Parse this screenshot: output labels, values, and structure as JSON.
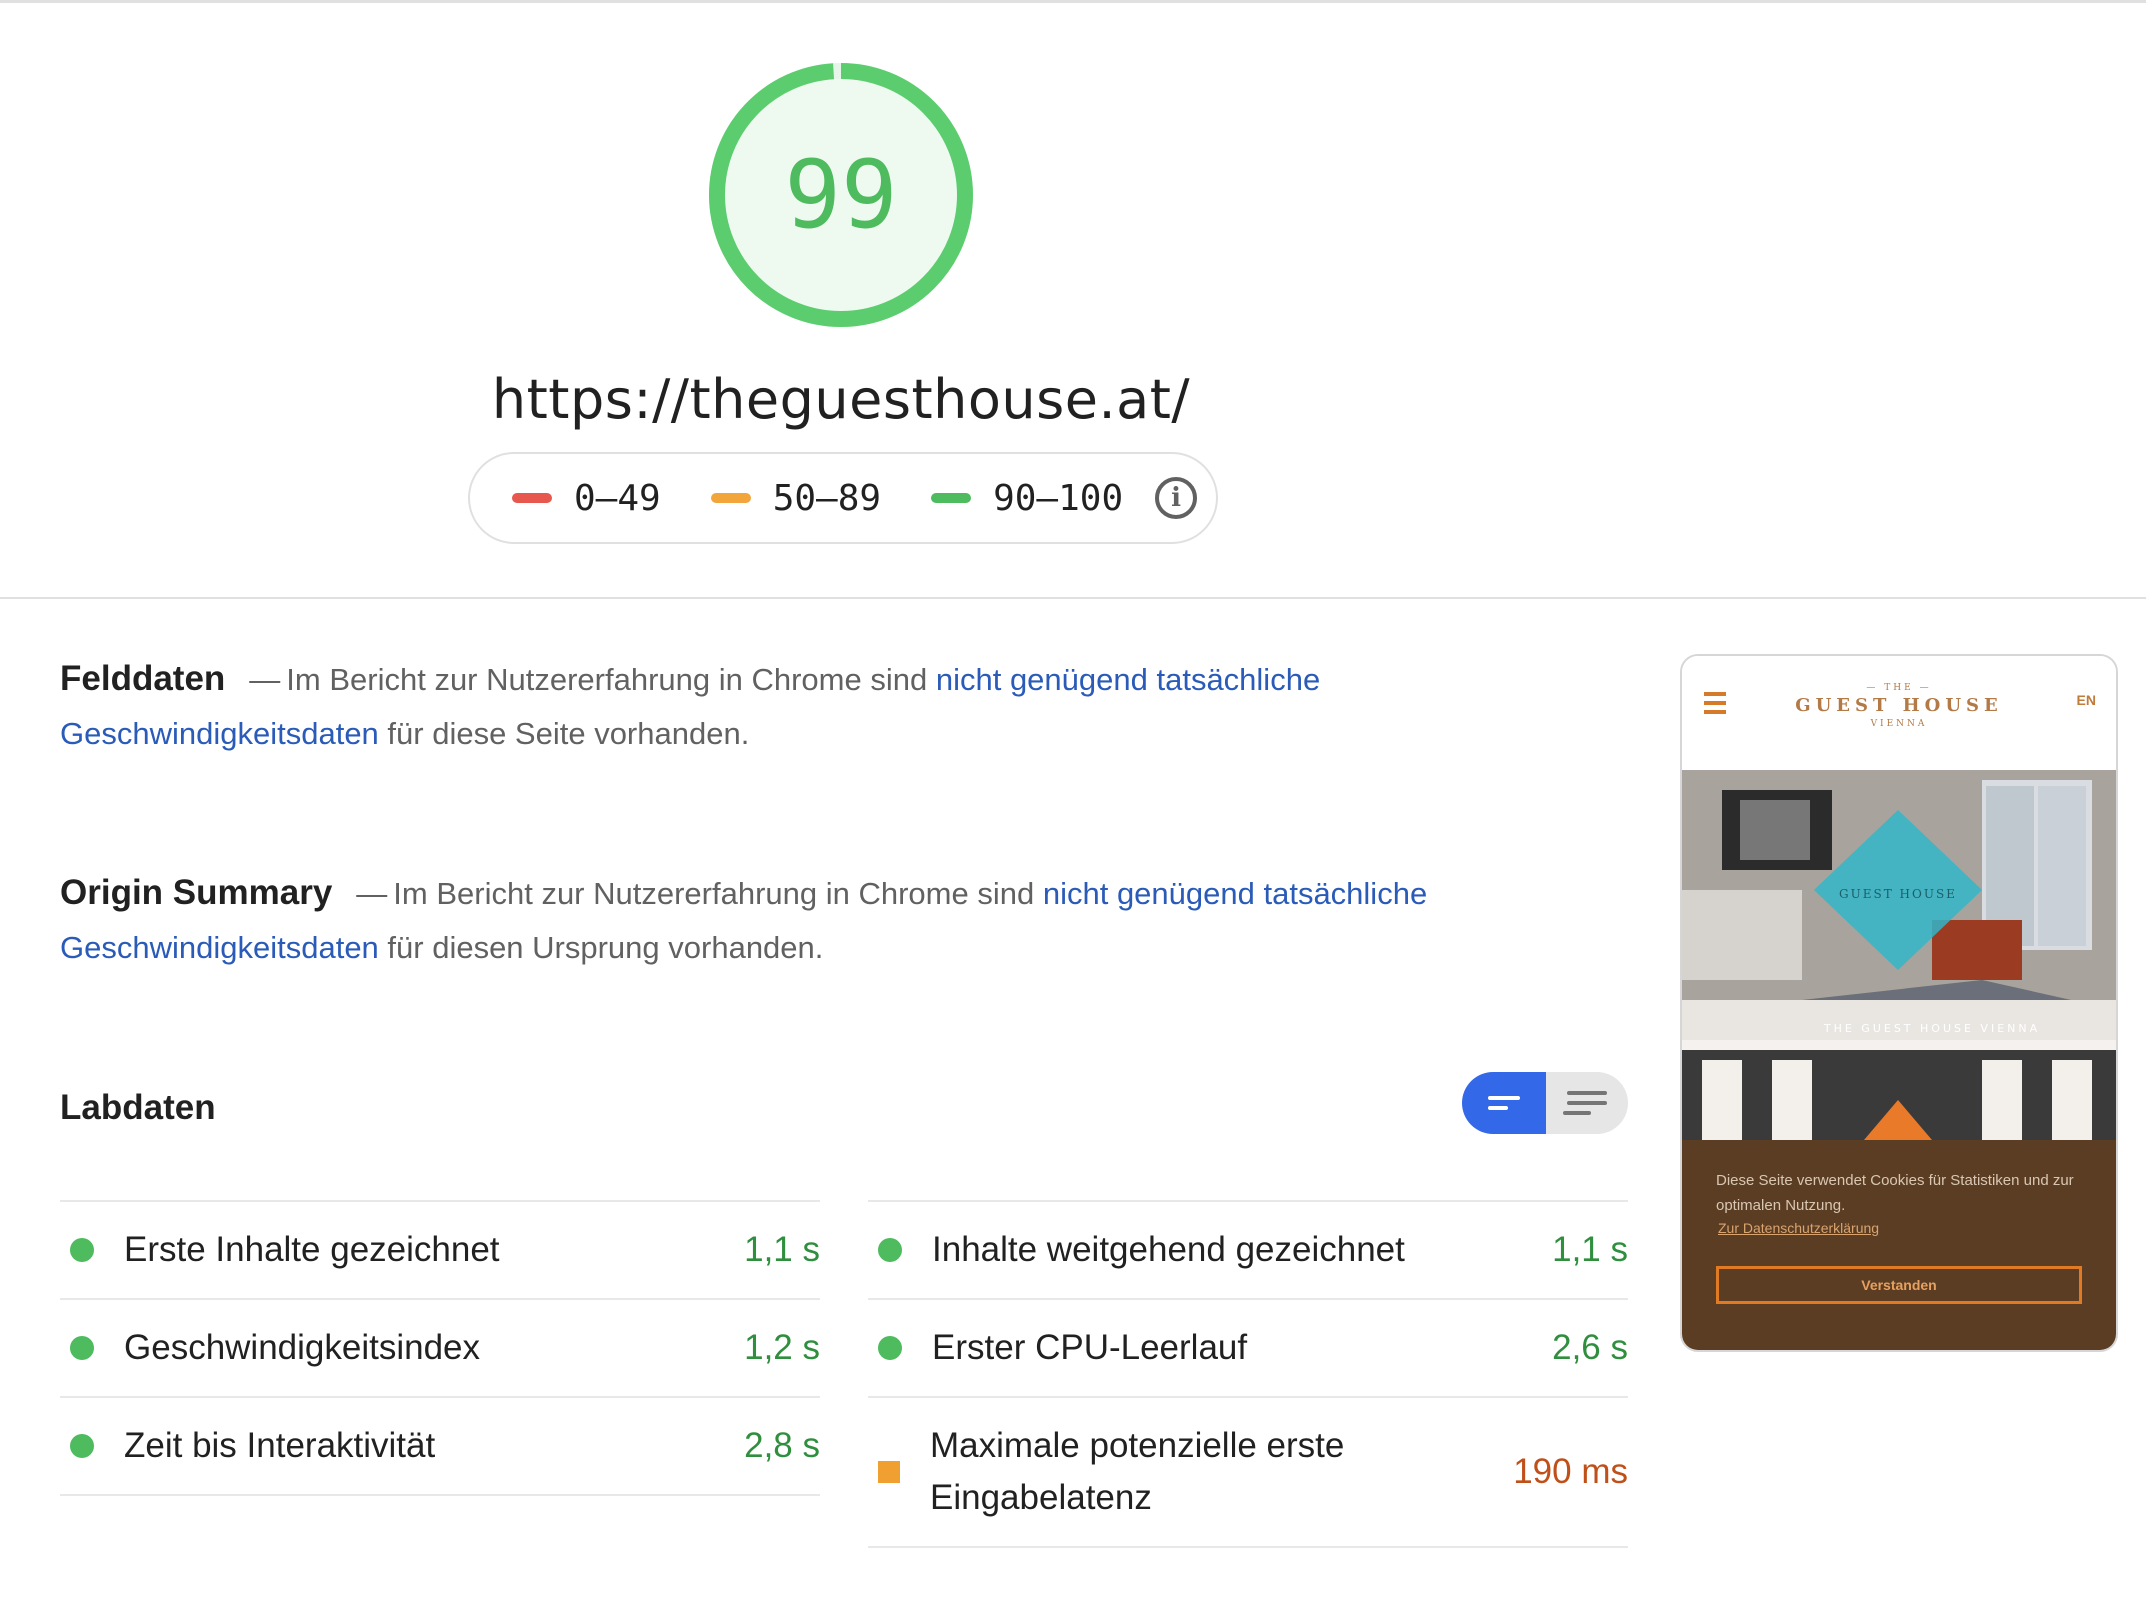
{
  "score": {
    "value": "99",
    "fraction": 0.99,
    "color": "#4dbb5e"
  },
  "url": "https://theguesthouse.at/",
  "legend": {
    "items": [
      {
        "label": "0–49",
        "color": "#e8574d"
      },
      {
        "label": "50–89",
        "color": "#f2a53a"
      },
      {
        "label": "90–100",
        "color": "#4dbb5e"
      }
    ],
    "info_icon": "i"
  },
  "field_data": {
    "title": "Felddaten",
    "dash": "—",
    "text_before": "Im Bericht zur Nutzererfahrung in Chrome sind ",
    "link": "nicht genügend tatsächliche Geschwindigkeitsdaten",
    "text_after": " für diese Seite vorhanden."
  },
  "origin_summary": {
    "title": "Origin Summary",
    "dash": "—",
    "text_before": "Im Bericht zur Nutzererfahrung in Chrome sind ",
    "link": "nicht genügend tatsächliche Geschwindigkeitsdaten",
    "text_after": " für diesen Ursprung vorhanden."
  },
  "lab_data": {
    "title": "Labdaten",
    "metrics_left": [
      {
        "name": "Erste Inhalte gezeichnet",
        "value": "1,1 s",
        "status": "good"
      },
      {
        "name": "Geschwindigkeitsindex",
        "value": "1,2 s",
        "status": "good"
      },
      {
        "name": "Zeit bis Interaktivität",
        "value": "2,8 s",
        "status": "good"
      }
    ],
    "metrics_right": [
      {
        "name": "Inhalte weitgehend gezeichnet",
        "value": "1,1 s",
        "status": "good"
      },
      {
        "name": "Erster CPU-Leerlauf",
        "value": "2,6 s",
        "status": "good"
      },
      {
        "name": "Maximale potenzielle erste Eingabelatenz",
        "value": "190 ms",
        "status": "average"
      }
    ]
  },
  "screenshot": {
    "brand_top": "— THE —",
    "brand_name": "GUEST HOUSE",
    "brand_bottom": "VIENNA",
    "lang": "EN",
    "hero_logo": "GUEST HOUSE",
    "facade_text": "THE GUEST HOUSE VIENNA",
    "cookie_text": "Diese Seite verwendet Cookies für Statistiken und zur optimalen Nutzung.",
    "cookie_link": "Zur Datenschutzerklärung",
    "cookie_button": "Verstanden"
  }
}
